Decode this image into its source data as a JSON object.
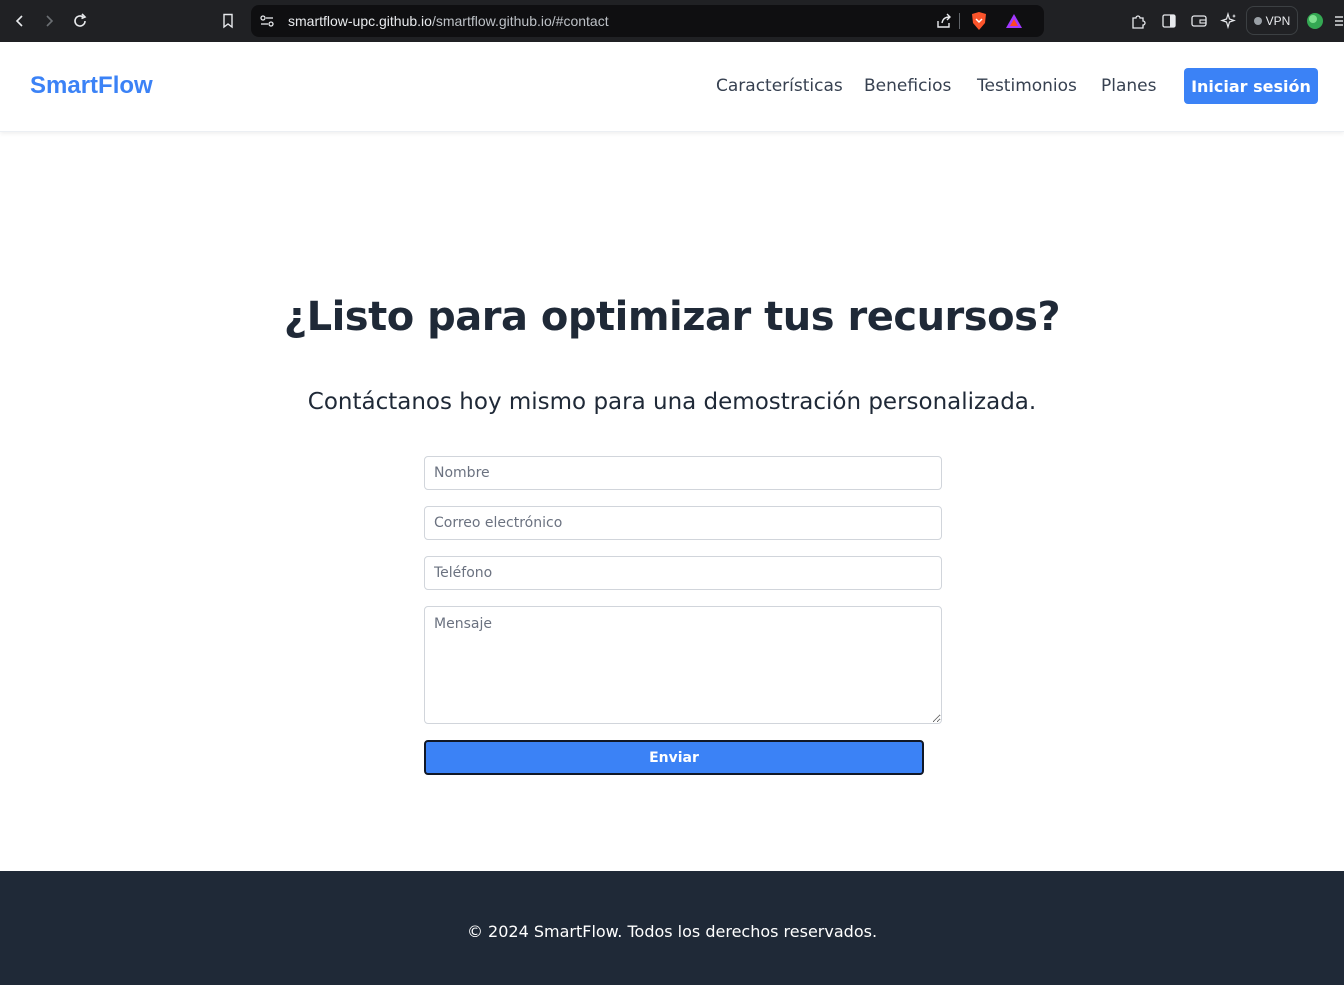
{
  "browser": {
    "url_host": "smartflow-upc.github.io",
    "url_path": "/smartflow.github.io/#contact",
    "vpn_label": "VPN",
    "icons": [
      "back-icon",
      "forward-icon",
      "reload-icon",
      "bookmark-icon",
      "site-settings-icon",
      "share-icon",
      "brave-shield-icon",
      "brave-rewards-icon",
      "extensions-icon",
      "sidebar-icon",
      "wallet-icon",
      "leo-ai-icon",
      "profile-icon",
      "menu-icon"
    ]
  },
  "header": {
    "logo": "SmartFlow",
    "nav": [
      "Características",
      "Beneficios",
      "Testimonios",
      "Planes"
    ],
    "login_label": "Iniciar sesión",
    "brand_color": "#3b82f6"
  },
  "contact": {
    "title": "¿Listo para optimizar tus recursos?",
    "subtitle": "Contáctanos hoy mismo para una demostración personalizada.",
    "name_placeholder": "Nombre",
    "email_placeholder": "Correo electrónico",
    "phone_placeholder": "Teléfono",
    "message_placeholder": "Mensaje",
    "submit_label": "Enviar"
  },
  "footer": {
    "text": "© 2024 SmartFlow. Todos los derechos reservados.",
    "background": "#1f2937"
  }
}
